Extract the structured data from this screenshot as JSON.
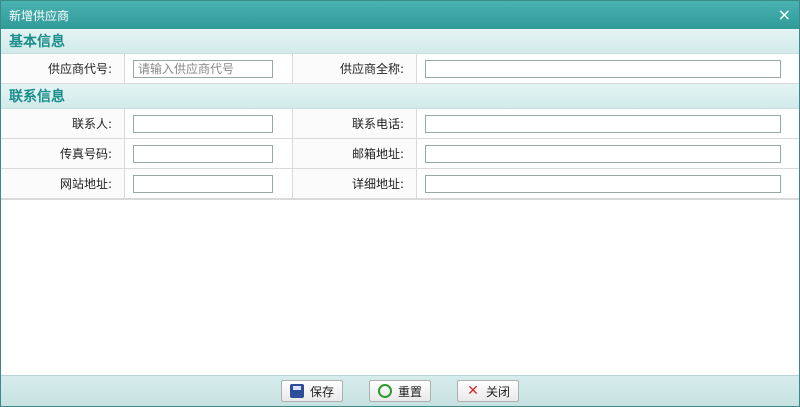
{
  "window": {
    "title": "新增供应商",
    "close_icon": "×"
  },
  "sections": {
    "basic": {
      "title": "基本信息"
    },
    "contact": {
      "title": "联系信息"
    }
  },
  "fields": {
    "supplier_code": {
      "label": "供应商代号:",
      "placeholder": "请输入供应商代号",
      "value": ""
    },
    "supplier_name": {
      "label": "供应商全称:",
      "value": ""
    },
    "contact_person": {
      "label": "联系人:",
      "value": ""
    },
    "contact_phone": {
      "label": "联系电话:",
      "value": ""
    },
    "fax": {
      "label": "传真号码:",
      "value": ""
    },
    "email": {
      "label": "邮箱地址:",
      "value": ""
    },
    "website": {
      "label": "网站地址:",
      "value": ""
    },
    "address": {
      "label": "详细地址:",
      "value": ""
    }
  },
  "buttons": {
    "save": {
      "label": "保存",
      "icon": "save-icon"
    },
    "reset": {
      "label": "重置",
      "icon": "refresh-icon"
    },
    "close": {
      "label": "关闭",
      "icon": "close-icon"
    }
  },
  "colors": {
    "accent": "#2f9a98",
    "section_text": "#1a8e8b"
  }
}
